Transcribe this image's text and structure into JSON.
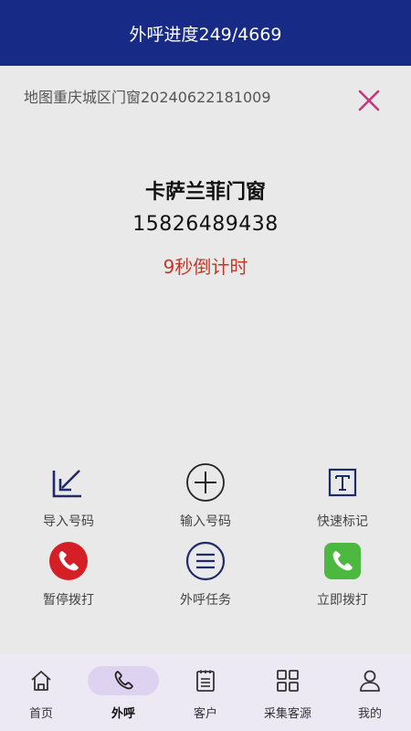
{
  "header": {
    "title": "外呼进度249/4669"
  },
  "task": {
    "name": "地图重庆城区门窗20240622181009"
  },
  "contact": {
    "name": "卡萨兰菲门窗",
    "phone": "15826489438",
    "countdown": "9秒倒计时"
  },
  "actions": [
    {
      "label": "导入号码",
      "icon": "import-icon"
    },
    {
      "label": "输入号码",
      "icon": "plus-circle-icon"
    },
    {
      "label": "快速标记",
      "icon": "text-tag-icon"
    },
    {
      "label": "暂停拨打",
      "icon": "phone-red-icon"
    },
    {
      "label": "外呼任务",
      "icon": "list-circle-icon"
    },
    {
      "label": "立即拨打",
      "icon": "phone-green-icon"
    }
  ],
  "tabs": [
    {
      "label": "首页",
      "icon": "home-icon"
    },
    {
      "label": "外呼",
      "icon": "phone-icon",
      "active": true
    },
    {
      "label": "客户",
      "icon": "clipboard-icon"
    },
    {
      "label": "采集客源",
      "icon": "grid-icon"
    },
    {
      "label": "我的",
      "icon": "user-icon"
    }
  ],
  "colors": {
    "header": "#162a86",
    "accent": "#c7357a",
    "countdown": "#c0392b",
    "icon_navy": "#1f2a6b",
    "pause_red": "#d51f26",
    "call_green": "#4cb83f"
  }
}
